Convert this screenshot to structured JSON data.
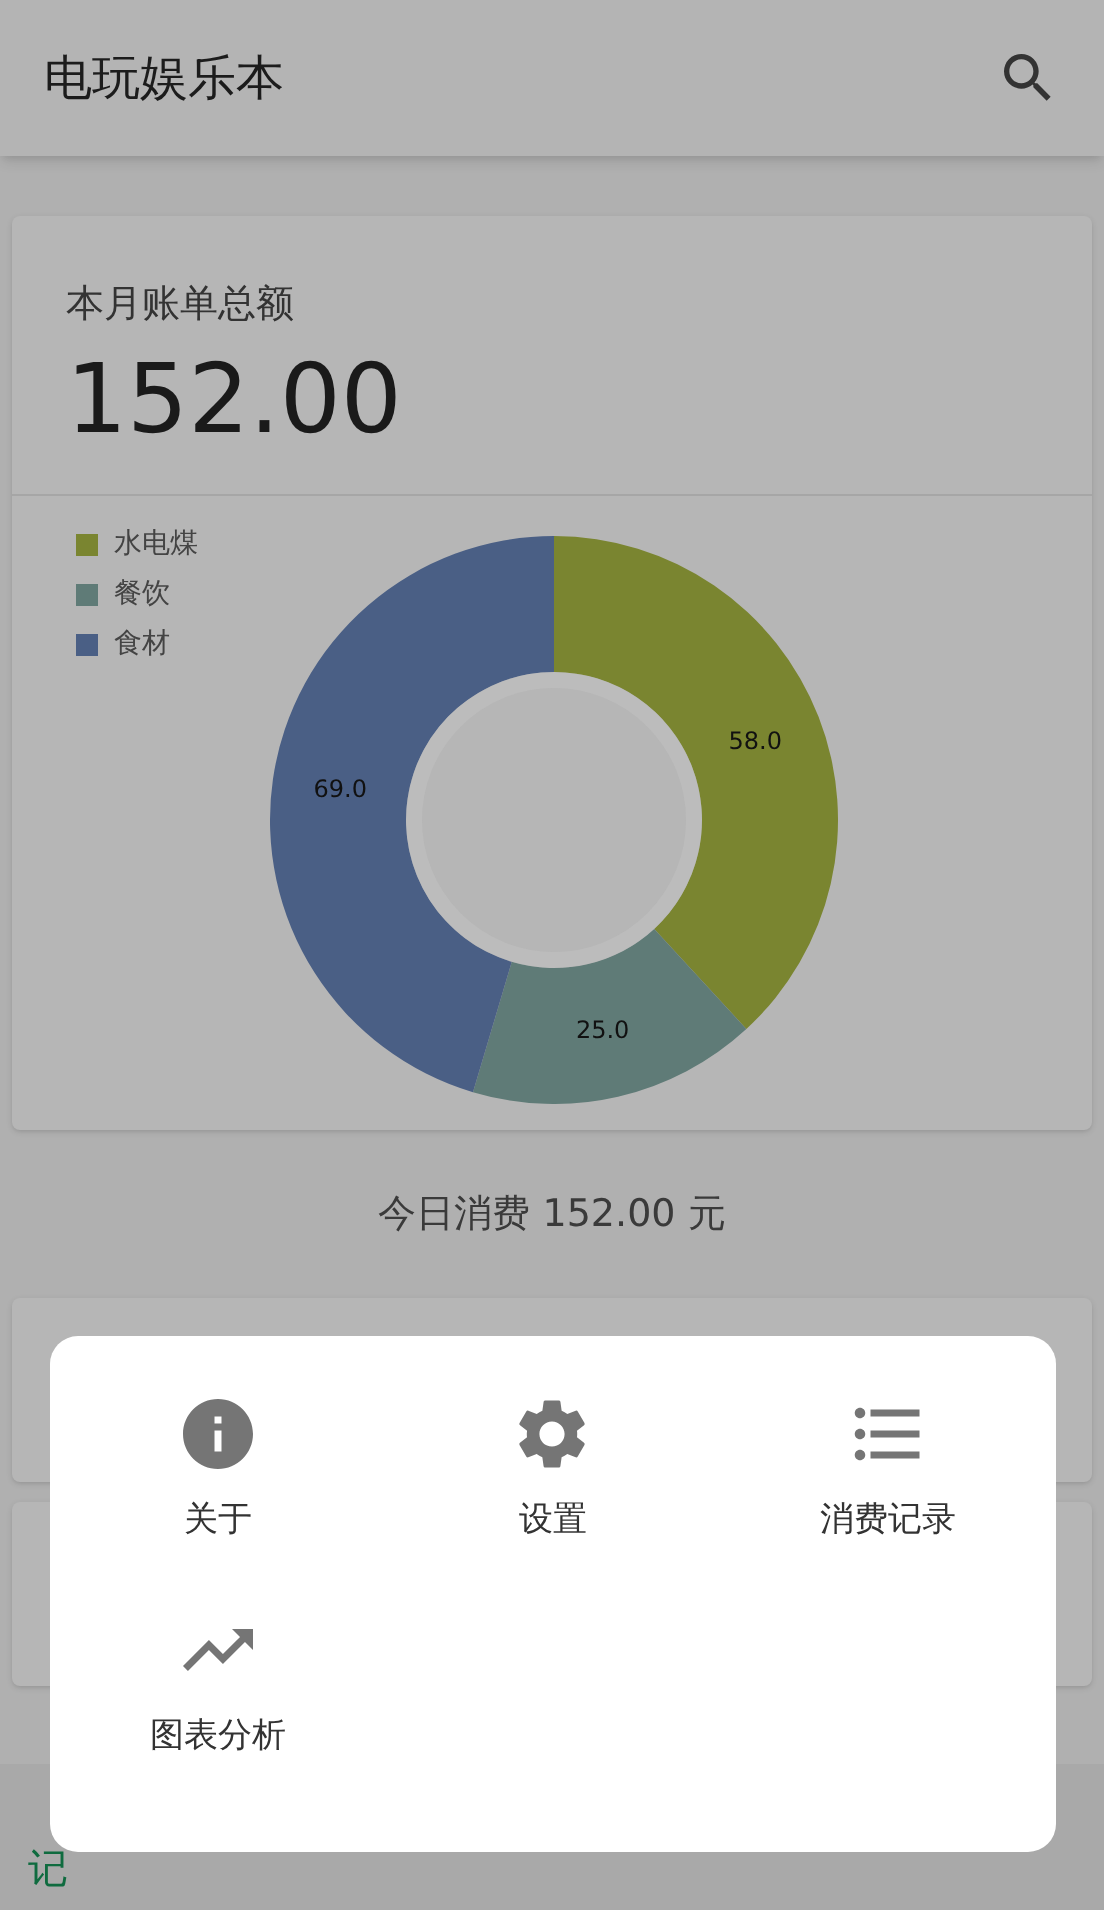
{
  "app_bar": {
    "title": "电玩娱乐本"
  },
  "summary": {
    "label": "本月账单总额",
    "amount": "152.00"
  },
  "chart_data": {
    "type": "donut",
    "categories": [
      "水电煤",
      "餐饮",
      "食材"
    ],
    "values": [
      58.0,
      25.0,
      69.0
    ],
    "colors": [
      "#7a8530",
      "#5f7b77",
      "#4a5f85"
    ],
    "value_labels": [
      "58.0",
      "25.0",
      "69.0"
    ],
    "legend": true
  },
  "today": "今日消费 152.00 元",
  "bottom_bar": {
    "label": "记"
  },
  "menu": {
    "items": [
      {
        "label": "关于",
        "kind": "info"
      },
      {
        "label": "设置",
        "kind": "settings"
      },
      {
        "label": "消费记录",
        "kind": "list"
      },
      {
        "label": "图表分析",
        "kind": "trend"
      }
    ]
  }
}
